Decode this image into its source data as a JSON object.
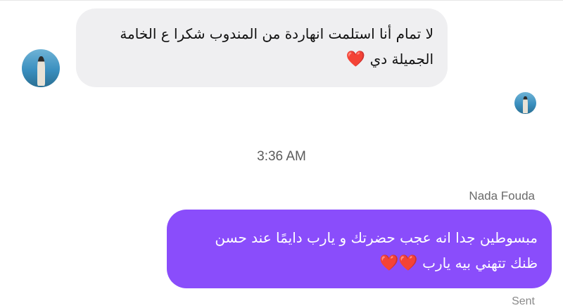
{
  "incoming_message": {
    "line1": "لا تمام أنا استلمت انهاردة من المندوب شكرا ع الخامة",
    "line2": "الجميلة دي",
    "emoji": "❤️"
  },
  "timestamp": "3:36 AM",
  "sender_name": "Nada Fouda",
  "outgoing_message": {
    "line1": "مبسوطين جدا انه عجب حضرتك و يارب دايمًا عند حسن",
    "line2": "ظنك تتهني بيه يارب",
    "emoji": "❤️❤️"
  },
  "status_label": "Sent",
  "colors": {
    "incoming_bubble": "#efeff1",
    "outgoing_bubble": "#8a4dfb",
    "heart": "#e11d2e"
  }
}
